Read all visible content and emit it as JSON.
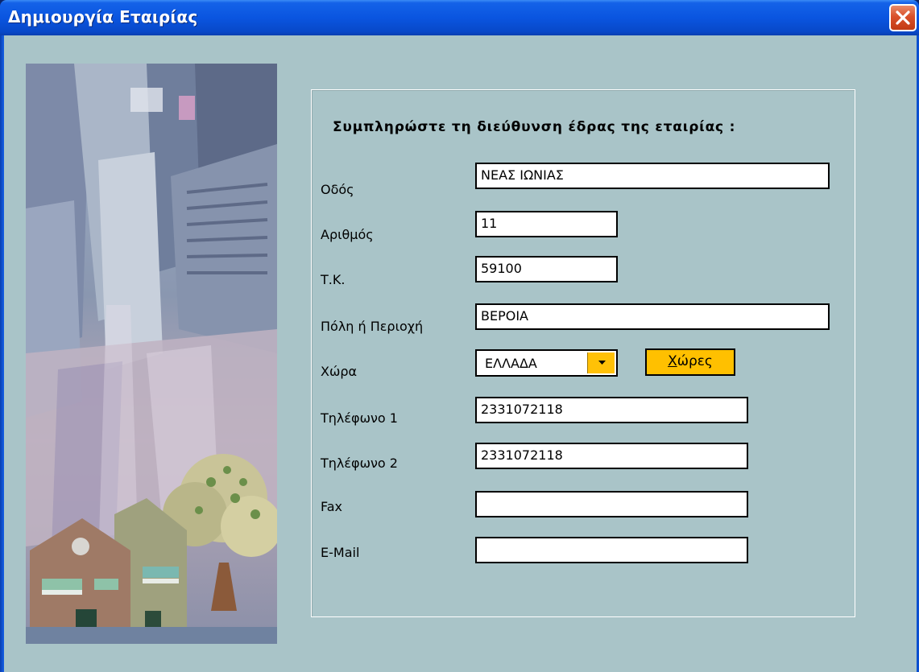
{
  "window": {
    "title": "Δημιουργία Εταιρίας"
  },
  "form": {
    "heading": "Συμπληρώστε τη διεύθυνση έδρας της εταιρίας :",
    "fields": {
      "street": {
        "label": "Οδός",
        "value": "ΝΕΑΣ ΙΩΝΙΑΣ"
      },
      "number": {
        "label": "Αριθμός",
        "value": "11"
      },
      "postal_code": {
        "label": "Τ.Κ.",
        "value": "59100"
      },
      "city": {
        "label": "Πόλη ή Περιοχή",
        "value": "ΒΕΡΟΙΑ"
      },
      "country": {
        "label": "Χώρα",
        "value": "ΕΛΛΑΔΑ"
      },
      "phone1": {
        "label": "Τηλέφωνο 1",
        "value": "2331072118"
      },
      "phone2": {
        "label": "Τηλέφωνο 2",
        "value": "2331072118"
      },
      "fax": {
        "label": "Fax",
        "value": ""
      },
      "email": {
        "label": "E-Mail",
        "value": ""
      }
    },
    "countries_button": {
      "label_first": "Χ",
      "label_rest": "ώρες"
    }
  },
  "icons": {
    "close": "close-icon",
    "dropdown": "chevron-down-icon"
  },
  "colors": {
    "titlebar": "#0a55e0",
    "client_background": "#a9c4c8",
    "accent_button": "#ffc000"
  }
}
